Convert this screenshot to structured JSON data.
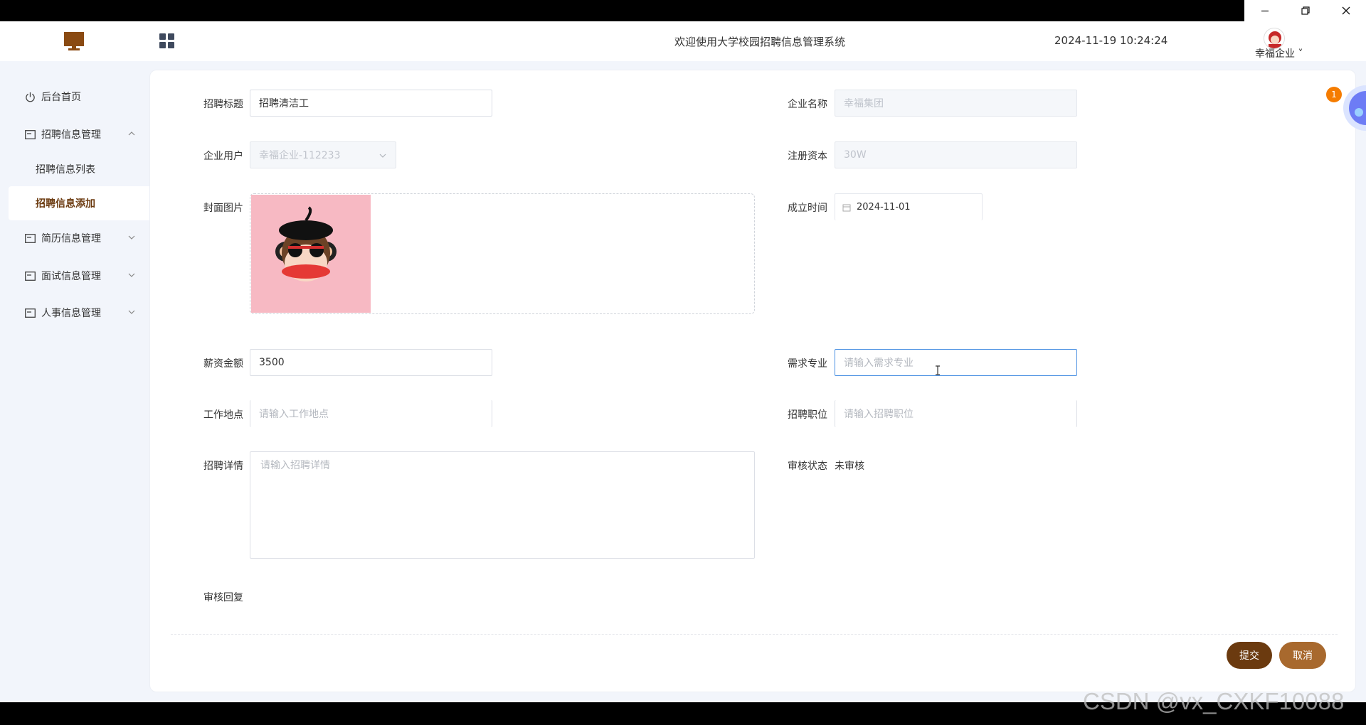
{
  "header": {
    "system_title": "欢迎使用大学校园招聘信息管理系统",
    "datetime": "2024-11-19 10:24:24",
    "user_label": "幸福企业"
  },
  "sidebar": {
    "items": [
      {
        "label": "后台首页"
      },
      {
        "label": "招聘信息管理",
        "expanded": true,
        "children": [
          {
            "label": "招聘信息列表"
          },
          {
            "label": "招聘信息添加",
            "active": true
          }
        ]
      },
      {
        "label": "简历信息管理"
      },
      {
        "label": "面试信息管理"
      },
      {
        "label": "人事信息管理"
      }
    ]
  },
  "form": {
    "title": {
      "label": "招聘标题",
      "value": "招聘清洁工"
    },
    "company_name": {
      "label": "企业名称",
      "value": "幸福集团"
    },
    "company_user": {
      "label": "企业用户",
      "value": "幸福企业-112233"
    },
    "registered_capital": {
      "label": "注册资本",
      "value": "30W"
    },
    "cover": {
      "label": "封面图片"
    },
    "founded": {
      "label": "成立时间",
      "value": "2024-11-01"
    },
    "salary": {
      "label": "薪资金额",
      "value": "3500"
    },
    "major": {
      "label": "需求专业",
      "placeholder": "请输入需求专业"
    },
    "location": {
      "label": "工作地点",
      "placeholder": "请输入工作地点"
    },
    "position": {
      "label": "招聘职位",
      "placeholder": "请输入招聘职位"
    },
    "details": {
      "label": "招聘详情",
      "placeholder": "请输入招聘详情"
    },
    "review_status": {
      "label": "审核状态",
      "value": "未审核"
    },
    "review_reply": {
      "label": "审核回复"
    }
  },
  "actions": {
    "submit": "提交",
    "cancel": "取消"
  },
  "notification_count": "1",
  "watermark": "CSDN @vx_CXKF10088",
  "colors": {
    "brand": "#6b3a0f",
    "cancel": "#a8692e",
    "focus": "#4a90e2"
  }
}
